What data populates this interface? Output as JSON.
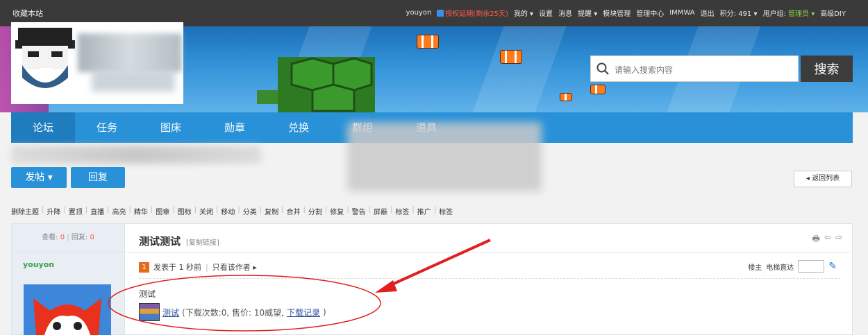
{
  "topbar": {
    "favorite": "收藏本站",
    "username": "youyon",
    "vip_text": "授权延期(剩余25天)",
    "items": [
      "我的 ▾",
      "设置",
      "消息",
      "提醒 ▾",
      "模块管理",
      "管理中心",
      "IMMWA",
      "退出"
    ],
    "points": "积分: 491 ▾",
    "group_label": "用户组:",
    "group_value": "管理员 ▾",
    "advanced": "高级DIY"
  },
  "search": {
    "placeholder": "请输入搜索内容",
    "button": "搜索"
  },
  "nav": {
    "items": [
      "论坛",
      "任务",
      "图床",
      "勋章",
      "兑换",
      "群组",
      "道具"
    ]
  },
  "actions": {
    "post": "发帖 ▾",
    "reply": "回复",
    "back": "◂ 返回列表"
  },
  "modbar": [
    "删除主题",
    "升降",
    "置顶",
    "直播",
    "高亮",
    "精华",
    "图章",
    "图标",
    "关闭",
    "移动",
    "分类",
    "复制",
    "合并",
    "分割",
    "修复",
    "警告",
    "屏蔽",
    "标签",
    "推广",
    "标签"
  ],
  "post": {
    "stats_view_label": "查看:",
    "stats_view": "0",
    "stats_reply_label": "回复:",
    "stats_reply": "0",
    "author": "youyon",
    "title": "测试测试",
    "copy_link": "[复制链接]",
    "badge": "1",
    "posted": "发表于 1 秒前",
    "only_author": "只看该作者 ▸",
    "floor": "楼主",
    "jump": "电梯直达",
    "body": "测试",
    "attachment": {
      "name": "测试",
      "detail": "(下载次数:0, 售价: 10威望, ",
      "record": "下载记录",
      "close": ")"
    }
  },
  "colors": {
    "nav": "#2891d8",
    "topbar": "#3a3a3a",
    "annotation": "#e02020"
  }
}
